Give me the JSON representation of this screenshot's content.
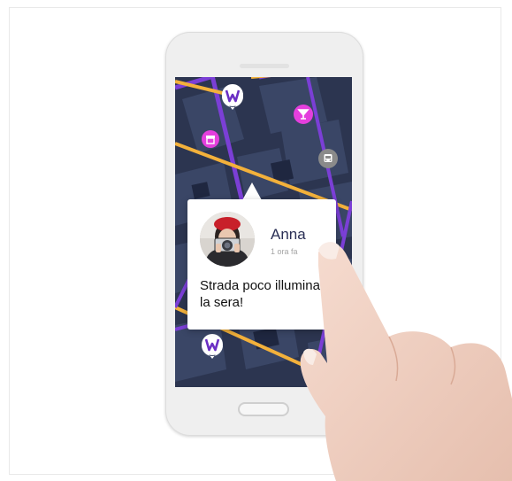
{
  "map": {
    "background_color": "#2c3550",
    "road_color_primary": "#7b3fd6",
    "road_color_secondary": "#f3b13b",
    "markers": [
      {
        "name": "brand-marker",
        "color": "#ffffff",
        "icon": "w-logo-icon"
      },
      {
        "name": "cocktail-marker",
        "color": "#e43fdd",
        "icon": "cocktail-icon"
      },
      {
        "name": "shop-marker",
        "color": "#e43fdd",
        "icon": "storefront-icon"
      },
      {
        "name": "bus-marker",
        "color": "#8a8a8a",
        "icon": "bus-icon"
      },
      {
        "name": "brand-marker",
        "color": "#ffffff",
        "icon": "w-logo-icon"
      }
    ]
  },
  "popup": {
    "user_name": "Anna",
    "time": "1 ora fa",
    "message": "Strada poco illuminata la sera!"
  },
  "colors": {
    "brand_purple": "#6b2fc4",
    "popup_name": "#2a2f55"
  }
}
